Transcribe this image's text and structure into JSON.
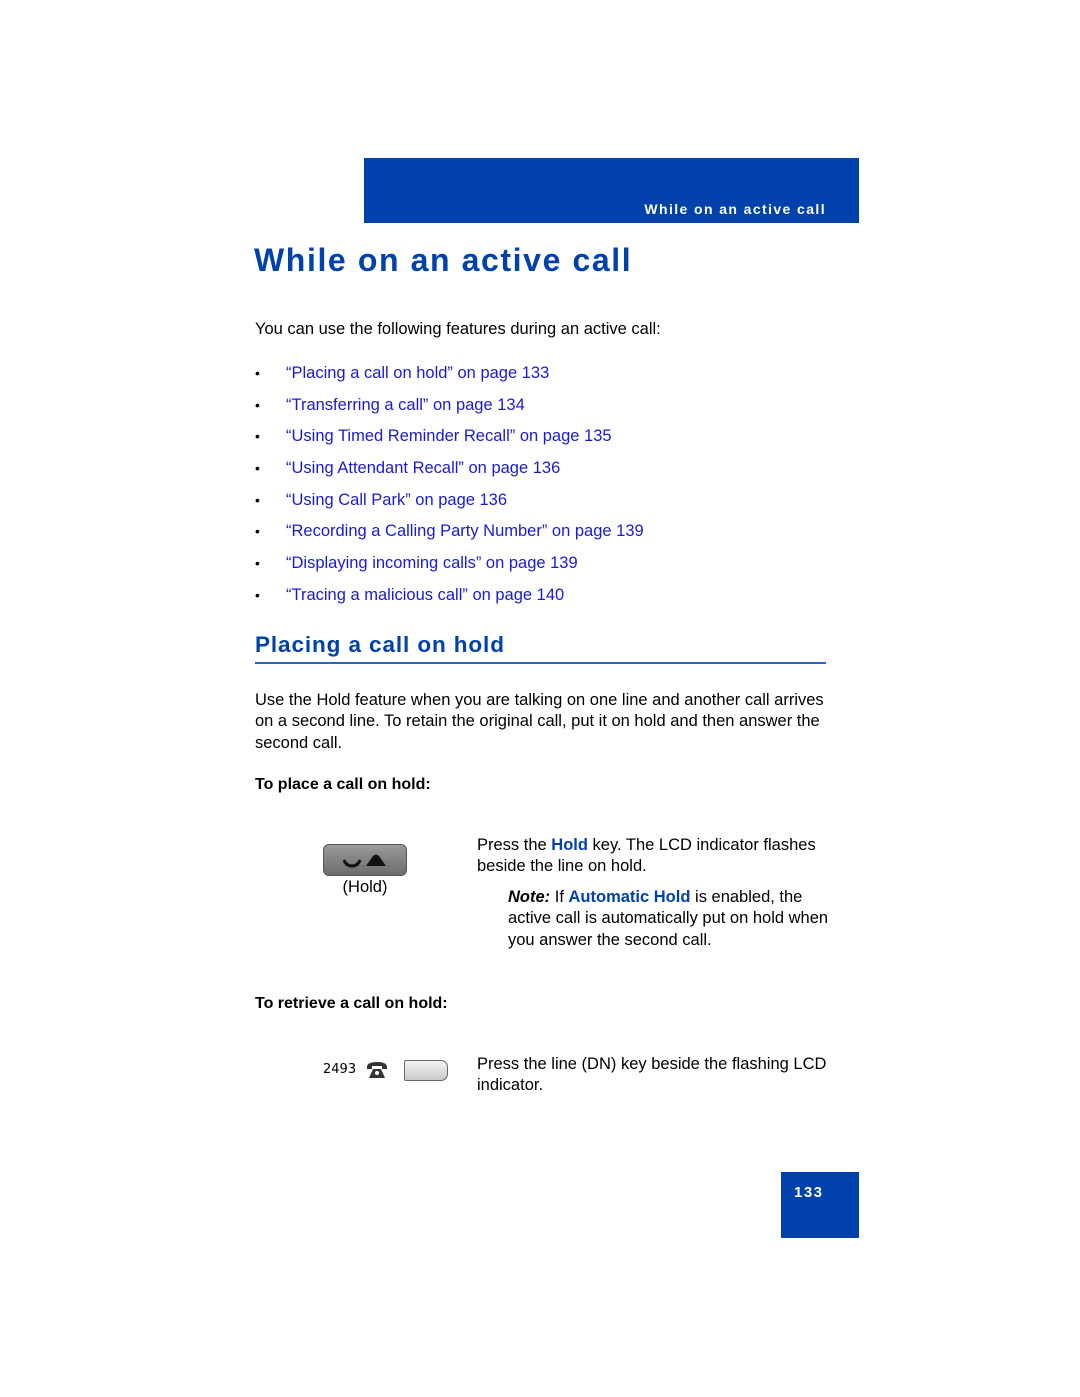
{
  "header": {
    "running_title": "While on an active call"
  },
  "page_title": "While on an active call",
  "intro": "You can use the following features during an active call:",
  "toc": [
    {
      "bullet": "•",
      "label": "“Placing a call on hold” on page 133"
    },
    {
      "bullet": "•",
      "label": "“Transferring a call” on page 134"
    },
    {
      "bullet": "•",
      "label": "“Using Timed Reminder Recall” on page 135"
    },
    {
      "bullet": "•",
      "label": "“Using Attendant Recall” on page 136"
    },
    {
      "bullet": "•",
      "label": "“Using Call Park” on page 136"
    },
    {
      "bullet": "•",
      "label": "“Recording a Calling Party Number” on page 139"
    },
    {
      "bullet": "•",
      "label": "“Displaying incoming calls” on page 139"
    },
    {
      "bullet": "•",
      "label": "“Tracing a malicious call” on page 140"
    }
  ],
  "section": {
    "title": "Placing a call on hold",
    "paragraph": "Use the Hold feature when you are talking on one line and another call arrives on a second line. To retain the original call, put it on hold and then answer the second call.",
    "place": {
      "heading": "To place a call on hold:",
      "key_caption": "(Hold)",
      "step_prefix": "Press the ",
      "step_key": "Hold",
      "step_suffix": " key. The LCD indicator flashes beside the line on hold.",
      "note_label": "Note:",
      "note_prefix": " If ",
      "note_feature": "Automatic Hold",
      "note_suffix": " is enabled, the active call is automatically put on hold when you answer the second call."
    },
    "retrieve": {
      "heading": "To retrieve a call on hold:",
      "dn": "2493",
      "step": "Press the line (DN) key beside the flashing LCD indicator."
    }
  },
  "footer": {
    "page_number": "133"
  },
  "colors": {
    "brand_blue": "#0041ab",
    "link_blue": "#1a1ad6"
  }
}
